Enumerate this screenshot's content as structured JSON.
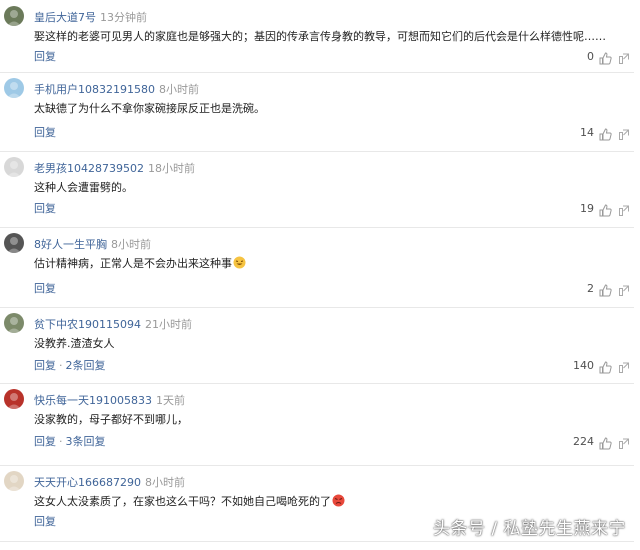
{
  "reply_label": "回复",
  "separator": "·",
  "comments": [
    {
      "username": "皇后大道7号",
      "time": "13分钟前",
      "text": "娶这样的老婆可见男人的家庭也是够强大的；基因的传承言传身教的教导，可想而知它们的后代会是什么样德性呢……",
      "replies": "",
      "likes": "0",
      "avatar_color": "#6b7a5a"
    },
    {
      "username": "手机用户10832191580",
      "time": "8小时前",
      "text": "太缺德了为什么不拿你家碗接尿反正也是洗碗。",
      "replies": "",
      "likes": "14",
      "avatar_color": "#9ec9e6"
    },
    {
      "username": "老男孩10428739502",
      "time": "18小时前",
      "text": "这种人会遭雷劈的。",
      "replies": "",
      "likes": "19",
      "avatar_color": "#d8d8d8"
    },
    {
      "username": "8好人一生平胸",
      "time": "8小时前",
      "text": "估计精神病，正常人是不会办出来这种事",
      "emoji": "laughing",
      "replies": "",
      "likes": "2",
      "avatar_color": "#555555"
    },
    {
      "username": "贫下中农190115094",
      "time": "21小时前",
      "text": "没教养.渣渣女人",
      "replies": "2条回复",
      "likes": "140",
      "avatar_color": "#7c8a6a"
    },
    {
      "username": "快乐每一天191005833",
      "time": "1天前",
      "text": "没家教的，母子都好不到哪儿，",
      "replies": "3条回复",
      "likes": "224",
      "avatar_color": "#b8322a"
    },
    {
      "username": "天天开心166687290",
      "time": "8小时前",
      "text": "这女人太没素质了，在家也这么干吗？不如她自己喝呛死的了",
      "emoji": "angry",
      "replies": "",
      "likes": "",
      "avatar_color": "#e2d6c4"
    }
  ],
  "watermark": "头条号 / 私塾先生燕来宁"
}
